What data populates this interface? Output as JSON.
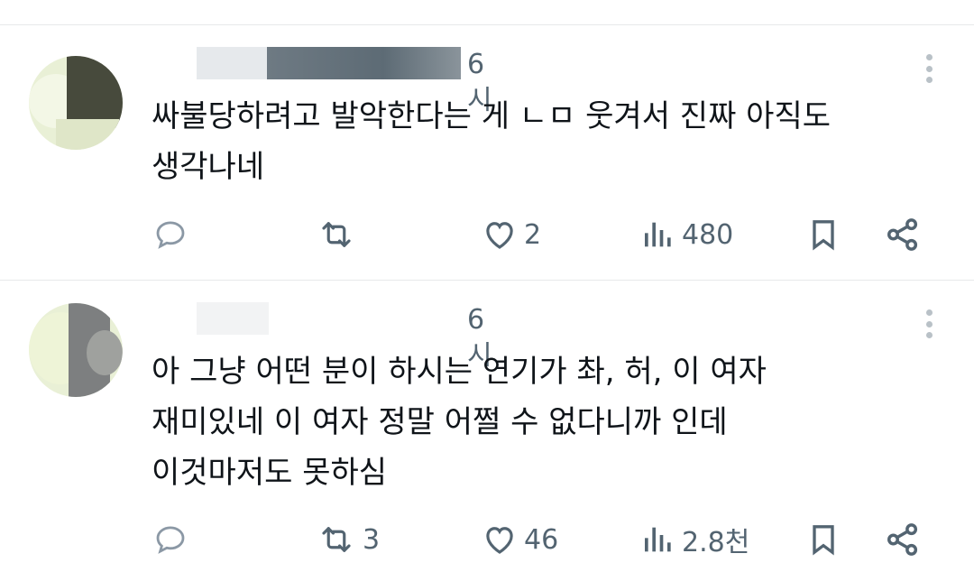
{
  "posts": [
    {
      "time": "6시",
      "text": "싸불당하려고 발악한다는 게 ㄴㅁ 웃겨서 진짜 아직도\n생각나네",
      "actions": {
        "reply_count": "",
        "repost_count": "",
        "like_count": "2",
        "views_count": "480"
      }
    },
    {
      "time": "6시",
      "text": "아 그냥 어떤 분이 하시는 연기가 촤, 허, 이 여자\n재미있네 이 여자 정말 어쩔 수 없다니까 인데\n이것마저도 못하심",
      "actions": {
        "reply_count": "",
        "repost_count": "3",
        "like_count": "46",
        "views_count": "2.8천"
      }
    }
  ],
  "icons": {
    "reply": "reply-icon",
    "repost": "repost-icon",
    "like": "heart-icon",
    "views": "views-icon",
    "bookmark": "bookmark-icon",
    "share": "share-icon",
    "more": "more-vertical-icon"
  },
  "colors": {
    "icon_gray": "#536471",
    "text": "#0f1419",
    "divider": "#e7e9ea"
  }
}
